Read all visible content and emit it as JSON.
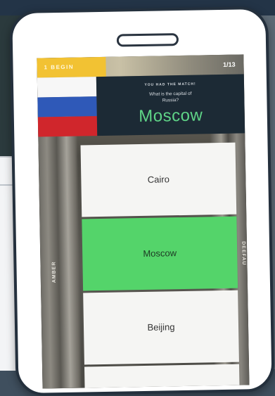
{
  "game": {
    "level_label": "1 BEGIN",
    "counter": "1/13",
    "question_header": "YOU HAD THE MATCH!",
    "question_text": "What is the capital of Russia?",
    "answer_display": "Moscow",
    "side_left": "AMBER",
    "side_right": "DEEFAU",
    "flag": {
      "colors": [
        "#f7f7f7",
        "#2f59b8",
        "#d0262c"
      ],
      "country": "Russia"
    },
    "options": [
      {
        "label": "Cairo",
        "selected": false
      },
      {
        "label": "Moscow",
        "selected": true
      },
      {
        "label": "Beijing",
        "selected": false
      },
      {
        "label": "",
        "selected": false
      }
    ],
    "colors": {
      "correct": "#54d46a",
      "badge": "#f2c233",
      "answer_text": "#5fd487"
    }
  }
}
